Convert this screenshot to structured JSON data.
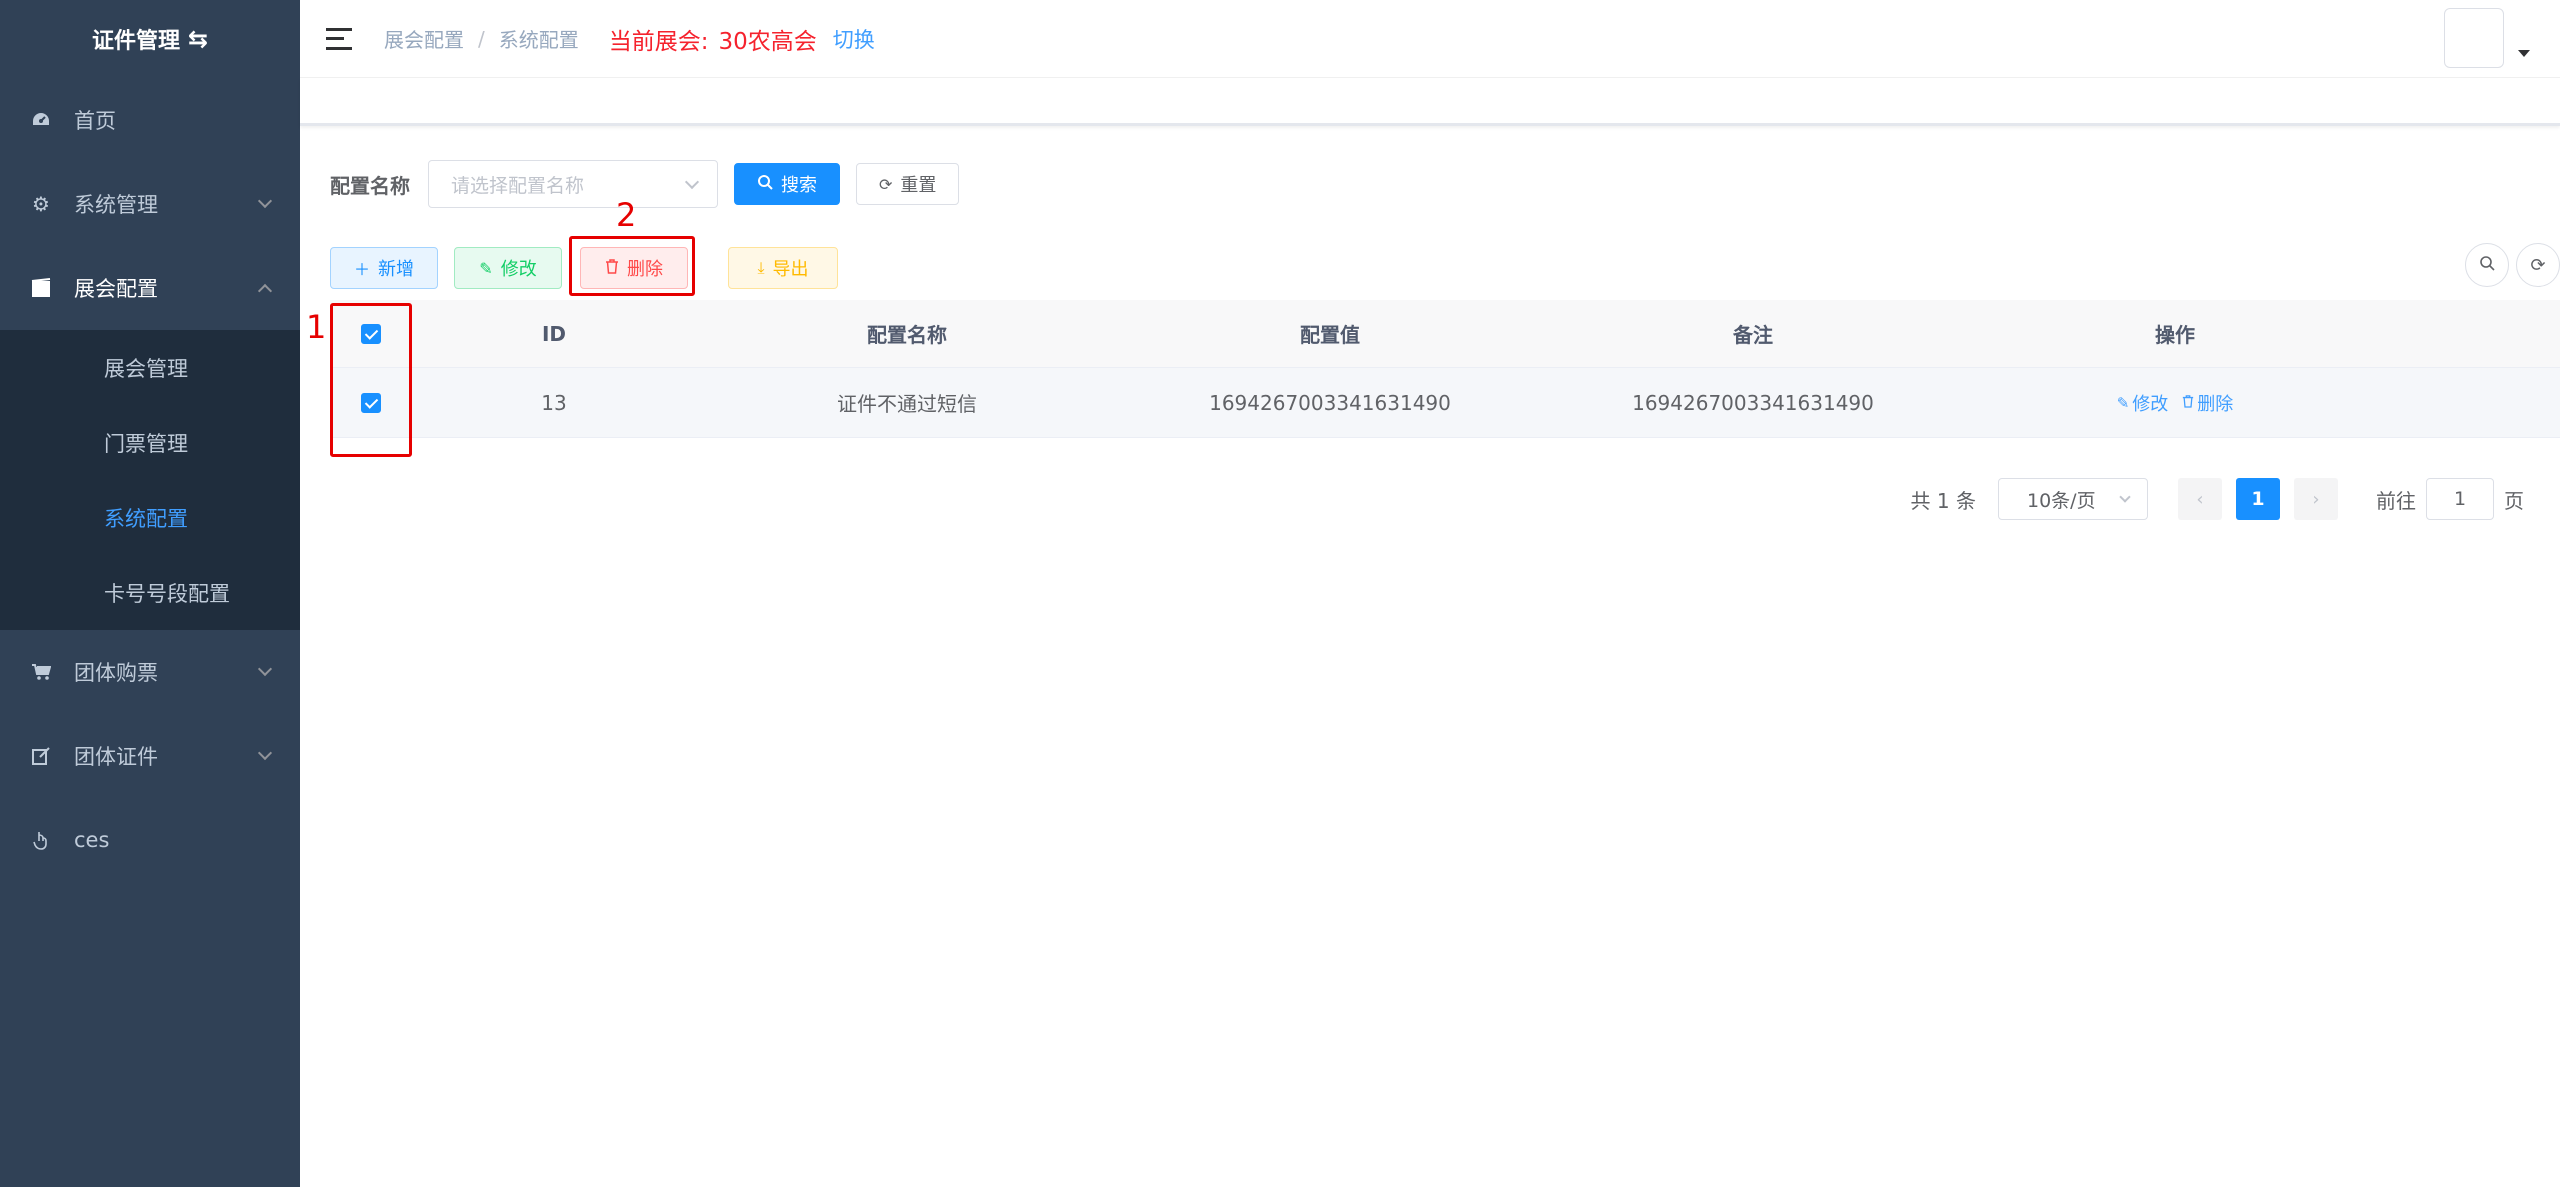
{
  "sidebar": {
    "logo": "证件管理",
    "logo_icon": "swap-icon",
    "items": [
      {
        "label": "首页",
        "icon": "dashboard-icon"
      },
      {
        "label": "系统管理",
        "icon": "gear-icon"
      },
      {
        "label": "展会配置",
        "icon": "clapper-icon"
      },
      {
        "label": "团体购票",
        "icon": "cart-icon"
      },
      {
        "label": "团体证件",
        "icon": "edit-icon"
      },
      {
        "label": "ces",
        "icon": "hand-pointer-icon"
      }
    ],
    "submenu": [
      {
        "label": "展会管理"
      },
      {
        "label": "门票管理"
      },
      {
        "label": "系统配置"
      },
      {
        "label": "卡号号段配置"
      }
    ]
  },
  "header": {
    "breadcrumb": [
      "展会配置",
      "系统配置"
    ],
    "breadcrumb_sep": "/",
    "current_label": "当前展会:",
    "current_value": "30农高会",
    "switch_label": "切换"
  },
  "search": {
    "field_label": "配置名称",
    "placeholder": "请选择配置名称",
    "search_button": "搜索",
    "reset_button": "重置"
  },
  "toolbar": {
    "add": "新增",
    "edit": "修改",
    "delete": "删除",
    "export": "导出"
  },
  "annotations": {
    "one": "1",
    "two": "2"
  },
  "table": {
    "columns": [
      "ID",
      "配置名称",
      "配置值",
      "备注",
      "操作"
    ],
    "rows": [
      {
        "checked": true,
        "id": "13",
        "name": "证件不通过短信",
        "value": "1694267003341631490",
        "remark": "1694267003341631490",
        "ops": [
          "修改",
          "删除"
        ]
      }
    ]
  },
  "pagination": {
    "total": "共 1 条",
    "page_size": "10条/页",
    "current_page": "1",
    "goto_label": "前往",
    "goto_value": "1",
    "goto_suffix": "页"
  },
  "colors": {
    "sidebar_bg": "#304156",
    "submenu_bg": "#1f2d3d",
    "primary": "#1890ff",
    "danger": "#ff4949",
    "annotation": "#e60000"
  }
}
